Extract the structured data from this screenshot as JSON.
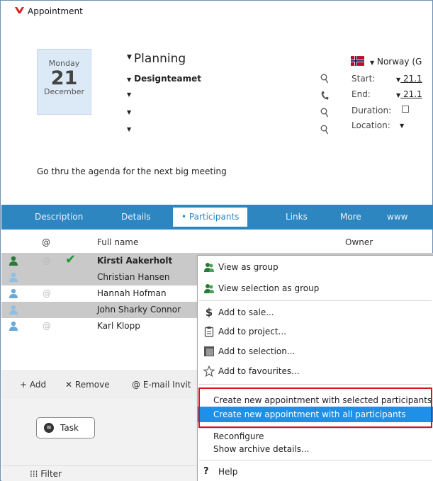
{
  "window": {
    "title": "Appointment"
  },
  "date_tile": {
    "weekday": "Monday",
    "day": "21",
    "month": "December"
  },
  "header": {
    "title": "Planning",
    "team": "Designteamet",
    "country": "Norway (G",
    "start_label": "Start:",
    "start_value": "21.1",
    "end_label": "End:",
    "end_value": "21.1",
    "duration_label": "Duration:",
    "location_label": "Location:"
  },
  "description_text": "Go thru the agenda for the next big meeting",
  "tabs": [
    {
      "label": "Description"
    },
    {
      "label": "Details"
    },
    {
      "label": "Participants",
      "bullet": "•"
    },
    {
      "label": "Links"
    },
    {
      "label": "More"
    },
    {
      "label": "www"
    }
  ],
  "grid": {
    "columns": {
      "at": "@",
      "full_name": "Full name",
      "owner": "Owner"
    },
    "rows": [
      {
        "name": "Kirsti Aakerholt",
        "at": "@",
        "accepted": true,
        "selected": true
      },
      {
        "name": "Christian Hansen",
        "at": "",
        "accepted": false,
        "selected": true
      },
      {
        "name": "Hannah Hofman",
        "at": "@",
        "accepted": false,
        "selected": false
      },
      {
        "name": "John Sharky Connor",
        "at": "",
        "accepted": false,
        "selected": true
      },
      {
        "name": "Karl Klopp",
        "at": "@",
        "accepted": false,
        "selected": false
      }
    ]
  },
  "bottom_toolbar": {
    "add": "Add",
    "remove": "Remove",
    "email": "E-mail Invit"
  },
  "task_button": {
    "label": "Task"
  },
  "statusbar": {
    "filter": "Filter"
  },
  "context_menu": {
    "view_as_group": "View as group",
    "view_selection_as_group": "View selection as group",
    "add_to_sale": "Add to sale...",
    "add_to_project": "Add to project...",
    "add_to_selection": "Add to selection...",
    "add_to_favourites": "Add to favourites...",
    "create_selected": "Create new appointment with selected participants",
    "create_all": "Create new appointment with all participants",
    "reconfigure": "Reconfigure",
    "show_archive": "Show archive details...",
    "help": "Help"
  },
  "colors": {
    "tabbar": "#2e86c1",
    "highlight": "#1e90e8",
    "red_box": "#d9141c"
  }
}
